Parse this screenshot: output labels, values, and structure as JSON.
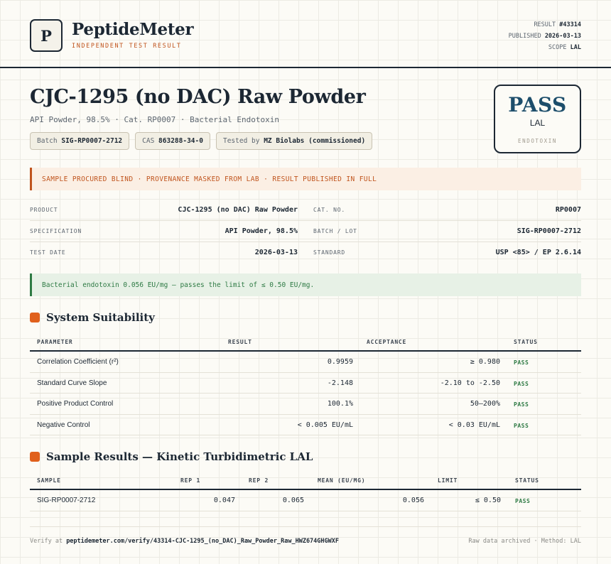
{
  "brand": {
    "logo_letter": "P",
    "name": "PeptideMeter",
    "tagline": "INDEPENDENT TEST RESULT"
  },
  "meta": {
    "result_label": "RESULT",
    "result_value": "#43314",
    "published_label": "PUBLISHED",
    "published_value": "2026-03-13",
    "scope_label": "SCOPE",
    "scope_value": "LAL"
  },
  "title": "CJC-1295 (no DAC) Raw Powder",
  "subtitle": "API Powder, 98.5% · Cat. RP0007 · Bacterial Endotoxin",
  "chips": {
    "batch_label": "Batch",
    "batch_value": "SIG-RP0007-2712",
    "cas_label": "CAS",
    "cas_value": "863288-34-0",
    "tested_label": "Tested by",
    "tested_value": "MZ Biolabs (commissioned)"
  },
  "stamp": {
    "verdict": "PASS",
    "scope": "LAL",
    "test": "ENDOTOXIN"
  },
  "notice_warn": "SAMPLE PROCURED BLIND · PROVENANCE MASKED FROM LAB · RESULT PUBLISHED IN FULL",
  "info": [
    {
      "k1": "PRODUCT",
      "v1": "CJC-1295 (no DAC) Raw Powder",
      "k2": "CAT. NO.",
      "v2": "RP0007"
    },
    {
      "k1": "SPECIFICATION",
      "v1": "API Powder, 98.5%",
      "k2": "BATCH / LOT",
      "v2": "SIG-RP0007-2712"
    },
    {
      "k1": "TEST DATE",
      "v1": "2026-03-13",
      "k2": "STANDARD",
      "v2": "USP <85> / EP 2.6.14"
    }
  ],
  "notice_ok": "Bacterial endotoxin 0.056 EU/mg — passes the limit of ≤ 0.50 EU/mg.",
  "suitability": {
    "title": "System Suitability",
    "headers": {
      "parameter": "PARAMETER",
      "result": "RESULT",
      "acceptance": "ACCEPTANCE",
      "status": "STATUS"
    },
    "rows": [
      {
        "parameter": "Correlation Coefficient (r²)",
        "result": "0.9959",
        "acceptance": "≥ 0.980",
        "status": "PASS"
      },
      {
        "parameter": "Standard Curve Slope",
        "result": "-2.148",
        "acceptance": "-2.10 to -2.50",
        "status": "PASS"
      },
      {
        "parameter": "Positive Product Control",
        "result": "100.1%",
        "acceptance": "50–200%",
        "status": "PASS"
      },
      {
        "parameter": "Negative Control",
        "result": "< 0.005 EU/mL",
        "acceptance": "< 0.03 EU/mL",
        "status": "PASS"
      }
    ]
  },
  "samples": {
    "title": "Sample Results — Kinetic Turbidimetric LAL",
    "headers": {
      "sample": "SAMPLE",
      "rep1": "REP 1",
      "rep2": "REP 2",
      "mean": "MEAN (EU/MG)",
      "limit": "LIMIT",
      "status": "STATUS"
    },
    "rows": [
      {
        "sample": "SIG-RP0007-2712",
        "rep1": "0.047",
        "rep2": "0.065",
        "mean": "0.056",
        "limit": "≤ 0.50",
        "status": "PASS"
      }
    ]
  },
  "footer": {
    "verify_label": "Verify at",
    "verify_url": "peptidemeter.com/verify/43314-CJC-1295_(no_DAC)_Raw_Powder_Raw_HWZ674GHGWXF",
    "right": "Raw data archived · Method: LAL"
  },
  "colors": {
    "accent": "#c0541d",
    "pass": "#2e7a44",
    "stamp": "#1d4e6b",
    "ink": "#1c2733"
  }
}
